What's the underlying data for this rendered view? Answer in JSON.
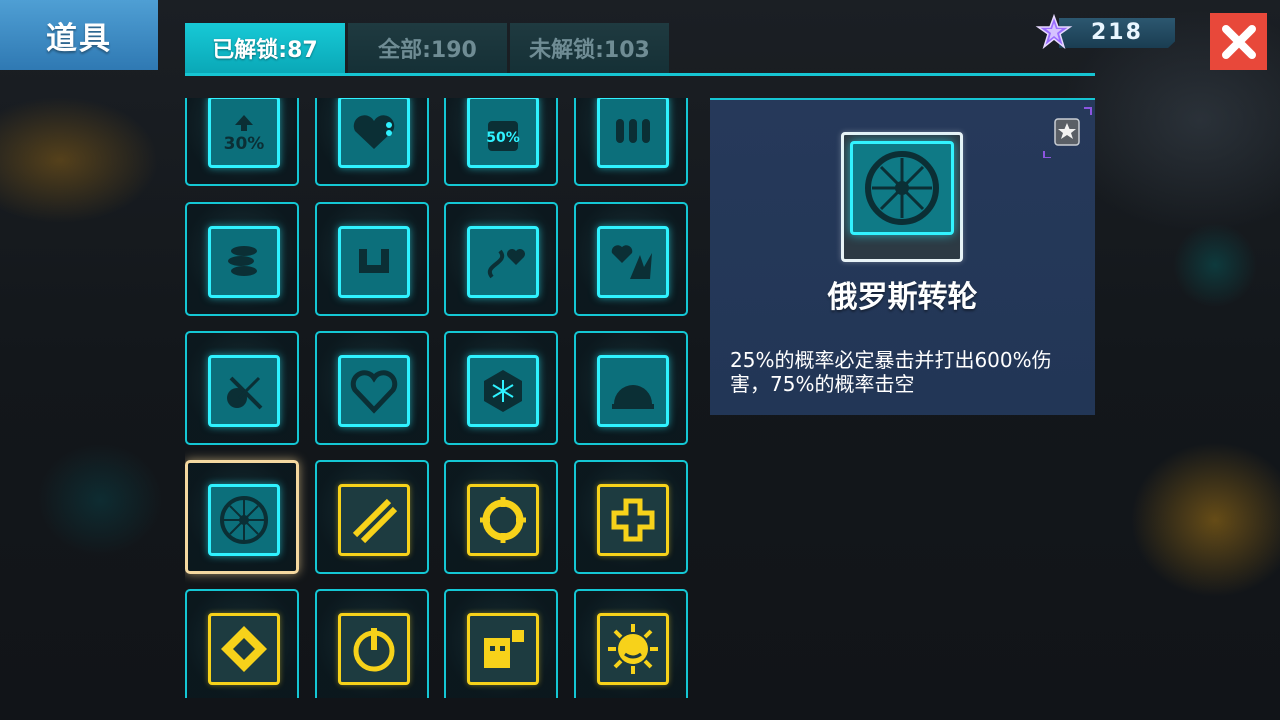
{
  "header": {
    "title": "道具"
  },
  "tabs": [
    {
      "label": "已解锁:87",
      "active": true
    },
    {
      "label": "全部:190",
      "active": false
    },
    {
      "label": "未解锁:103",
      "active": false
    }
  ],
  "currency": {
    "icon": "purple-star-icon",
    "value": "218"
  },
  "close": {
    "icon": "close-icon",
    "color": "#e8483a"
  },
  "colors": {
    "accent_cyan": "#16c5d3",
    "icon_cyan": "#2ff2ff",
    "icon_yellow": "#f7d21a",
    "selected_frame": "#f4d8a0"
  },
  "grid": {
    "items": [
      {
        "icon": "speed-boost-30-icon",
        "text": "30%",
        "color": "cyan"
      },
      {
        "icon": "heart-regen-icon",
        "color": "cyan"
      },
      {
        "icon": "shield-50-icon",
        "text": "50%",
        "color": "cyan"
      },
      {
        "icon": "bullets-icon",
        "color": "cyan"
      },
      {
        "icon": "coins-stack-icon",
        "color": "cyan"
      },
      {
        "icon": "magnet-icon",
        "color": "cyan"
      },
      {
        "icon": "heart-path-icon",
        "color": "cyan"
      },
      {
        "icon": "heart-explosion-icon",
        "color": "cyan"
      },
      {
        "icon": "skull-sword-icon",
        "color": "cyan"
      },
      {
        "icon": "heart-frame-icon",
        "color": "cyan"
      },
      {
        "icon": "snowflake-hex-icon",
        "color": "cyan"
      },
      {
        "icon": "alarm-helmet-icon",
        "color": "cyan"
      },
      {
        "icon": "roulette-wheel-icon",
        "color": "cyan",
        "selected": true
      },
      {
        "icon": "diagonal-arrows-icon",
        "color": "yellow"
      },
      {
        "icon": "target-ring-icon",
        "color": "yellow"
      },
      {
        "icon": "puzzle-cross-icon",
        "color": "yellow"
      },
      {
        "icon": "diamond-icon",
        "color": "yellow"
      },
      {
        "icon": "power-icon",
        "color": "yellow"
      },
      {
        "icon": "monster-blocks-icon",
        "color": "yellow"
      },
      {
        "icon": "angry-sun-icon",
        "color": "yellow"
      }
    ]
  },
  "detail": {
    "name": "俄罗斯转轮",
    "description": "25%的概率必定暴击并打出600%伤害，75%的概率击空",
    "icon": "roulette-wheel-icon",
    "badge_icon": "silver-star-badge-icon"
  }
}
